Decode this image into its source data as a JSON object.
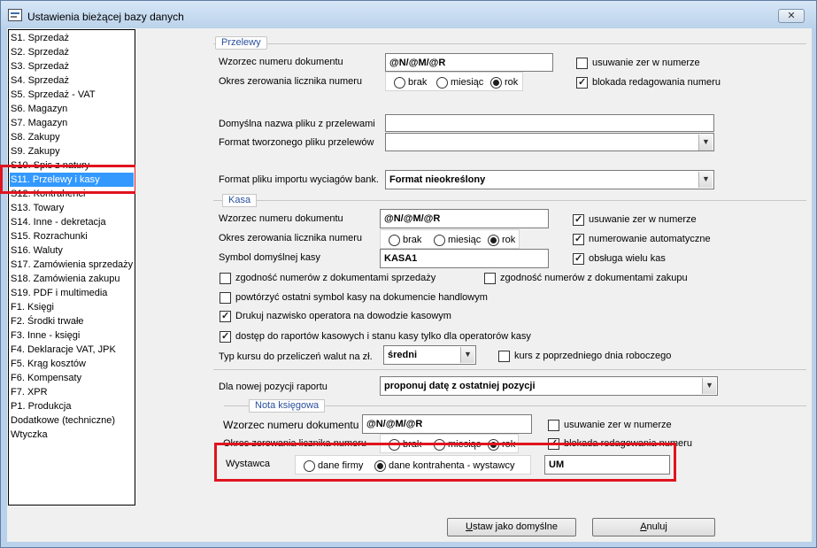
{
  "window": {
    "title": "Ustawienia bieżącej bazy danych",
    "close_label": "✕"
  },
  "sidebar": {
    "items": [
      "S1. Sprzedaż",
      "S2. Sprzedaż",
      "S3. Sprzedaż",
      "S4. Sprzedaż",
      "S5. Sprzedaż - VAT",
      "S6. Magazyn",
      "S7. Magazyn",
      "S8. Zakupy",
      "S9. Zakupy",
      "S10. Spis z natury",
      "S11. Przelewy i kasy",
      "S12. Kontrahenci",
      "S13. Towary",
      "S14. Inne - dekretacja",
      "S15. Rozrachunki",
      "S16. Waluty",
      "S17. Zamówienia sprzedaży",
      "S18. Zamówienia zakupu",
      "S19. PDF i multimedia",
      "F1. Księgi",
      "F2. Środki trwałe",
      "F3. Inne - księgi",
      "F4. Deklaracje VAT, JPK",
      "F5. Krąg kosztów",
      "F6. Kompensaty",
      "F7. XPR",
      "P1. Produkcja",
      "Dodatkowe (techniczne)",
      "Wtyczka"
    ],
    "selected_index": 10
  },
  "przelewy": {
    "legend": "Przelewy",
    "wzorzec_label": "Wzorzec numeru dokumentu",
    "wzorzec_value": "@N/@M/@R",
    "okres_label": "Okres zerowania licznika numeru",
    "radio_brak": "brak",
    "radio_miesiac": "miesiąc",
    "radio_rok": "rok",
    "usuwanie_label": "usuwanie zer w numerze",
    "usuwanie_checked": false,
    "blokada_label": "blokada redagowania numeru",
    "blokada_checked": true,
    "nazwa_pliku_label": "Domyślna nazwa pliku z przelewami",
    "nazwa_pliku_value": "",
    "format_tworzonego_label": "Format tworzonego pliku przelewów",
    "format_tworzonego_value": "",
    "format_importu_label": "Format pliku importu wyciagów bank.",
    "format_importu_value": "Format nieokreślony"
  },
  "kasa": {
    "legend": "Kasa",
    "wzorzec_label": "Wzorzec numeru dokumentu",
    "wzorzec_value": "@N/@M/@R",
    "okres_label": "Okres zerowania licznika numeru",
    "radio_brak": "brak",
    "radio_miesiac": "miesiąc",
    "radio_rok": "rok",
    "symbol_label": "Symbol domyślnej kasy",
    "symbol_value": "KASA1",
    "usuwanie_label": "usuwanie zer w numerze",
    "usuwanie_checked": true,
    "numerowanie_label": "numerowanie automatyczne",
    "numerowanie_checked": true,
    "obsluga_label": "obsługa wielu kas",
    "obsluga_checked": true,
    "zgodnosc_sprzedazy_label": "zgodność numerów z dokumentami sprzedaży",
    "zgodnosc_zakupu_label": "zgodność numerów z dokumentami zakupu",
    "powtorzyc_label": "powtórzyć ostatni symbol kasy na dokumencie handlowym",
    "drukuj_label": "Drukuj nazwisko operatora na dowodzie kasowym",
    "dostep_label": "dostęp do raportów kasowych i stanu kasy tylko dla operatorów kasy",
    "typ_kursu_label": "Typ kursu do przeliczeń walut na zł.",
    "typ_kursu_value": "średni",
    "kurs_poprzedni_label": "kurs z poprzedniego dnia roboczego"
  },
  "nowa_pozycja": {
    "label": "Dla nowej pozycji  raportu",
    "value": "proponuj datę z ostatniej pozycji"
  },
  "nota": {
    "legend": "Nota księgowa",
    "wzorzec_label": "Wzorzec numeru dokumentu",
    "wzorzec_value": "@N/@M/@R",
    "okres_label": "Okres zerowania licznika numeru",
    "radio_brak": "brak",
    "radio_miesiac": "miesiąc",
    "radio_rok": "rok",
    "usuwanie_label": "usuwanie zer w numerze",
    "blokada_label": "blokada redagowania numeru",
    "wystawca_label": "Wystawca",
    "radio_firmy": "dane firmy",
    "radio_kontrahenta": "dane kontrahenta - wystawcy",
    "wystawca_value": "UM"
  },
  "buttons": {
    "ustaw_pre": "U",
    "ustaw_rest": "staw jako domyślne",
    "anuluj_pre": "A",
    "anuluj_rest": "nuluj"
  },
  "colors": {
    "highlight": "#e0141e",
    "selection": "#3399ff",
    "legend_text": "#2a4f9c"
  }
}
